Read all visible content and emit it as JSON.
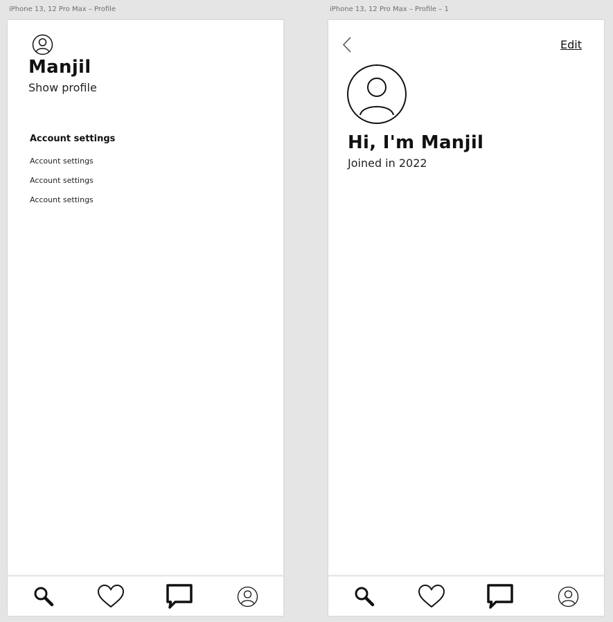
{
  "artboards": {
    "left": {
      "label": "iPhone 13, 12 Pro Max – Profile"
    },
    "right": {
      "label": "iPhone 13, 12 Pro Max – Profile – 1"
    }
  },
  "profile_menu": {
    "name": "Manjil",
    "show_profile_label": "Show profile",
    "settings_heading": "Account settings",
    "settings_items": [
      "Account settings",
      "Account settings",
      "Account settings"
    ]
  },
  "profile_detail": {
    "edit_label": "Edit",
    "greeting": "Hi, I'm Manjil",
    "joined_text": "Joined in 2022"
  },
  "tabbar": {
    "icons": [
      "search-icon",
      "heart-icon",
      "chat-icon",
      "user-icon"
    ]
  },
  "colors": {
    "background": "#e5e5e5",
    "artboard": "#ffffff",
    "ink": "#111111"
  }
}
